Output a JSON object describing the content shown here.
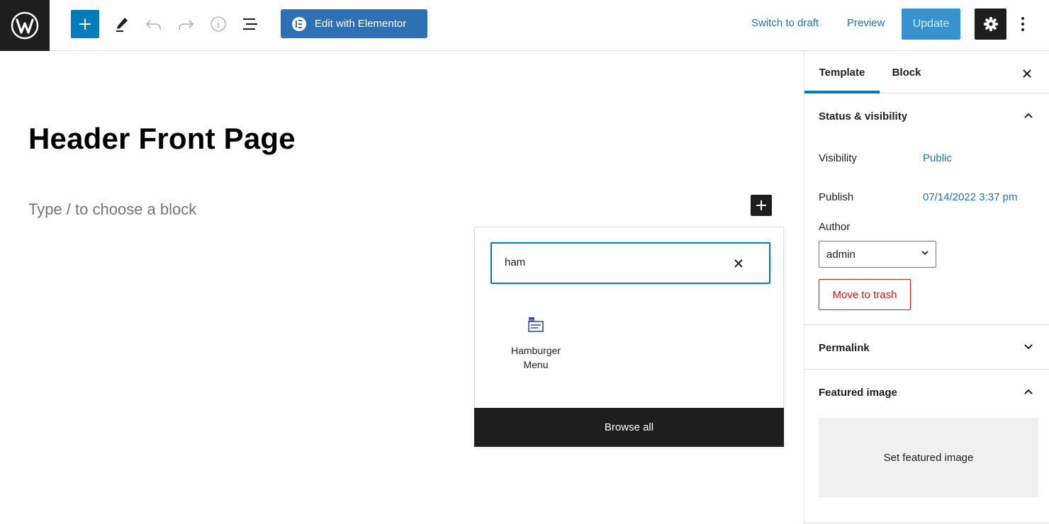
{
  "toolbar": {
    "elementor_label": "Edit with Elementor",
    "switch_to_draft": "Switch to draft",
    "preview": "Preview",
    "update": "Update"
  },
  "editor": {
    "page_title": "Header Front Page",
    "block_placeholder": "Type / to choose a block"
  },
  "inserter": {
    "search_value": "ham",
    "results": [
      {
        "label": "Hamburger Menu",
        "icon": "hamburger-menu-block-icon"
      }
    ],
    "browse_all": "Browse all"
  },
  "sidebar": {
    "tabs": [
      "Template",
      "Block"
    ],
    "status_visibility": {
      "title": "Status & visibility",
      "visibility_label": "Visibility",
      "visibility_value": "Public",
      "publish_label": "Publish",
      "publish_value": "07/14/2022 3:37 pm",
      "author_label": "Author",
      "author_value": "admin",
      "trash_label": "Move to trash"
    },
    "permalink": {
      "title": "Permalink"
    },
    "featured_image": {
      "title": "Featured image",
      "set_label": "Set featured image"
    }
  },
  "colors": {
    "accent": "#007cba",
    "elementor": "#2e70b4",
    "link": "#2271b1",
    "danger": "#cc1818",
    "dark": "#1e1e1e"
  }
}
